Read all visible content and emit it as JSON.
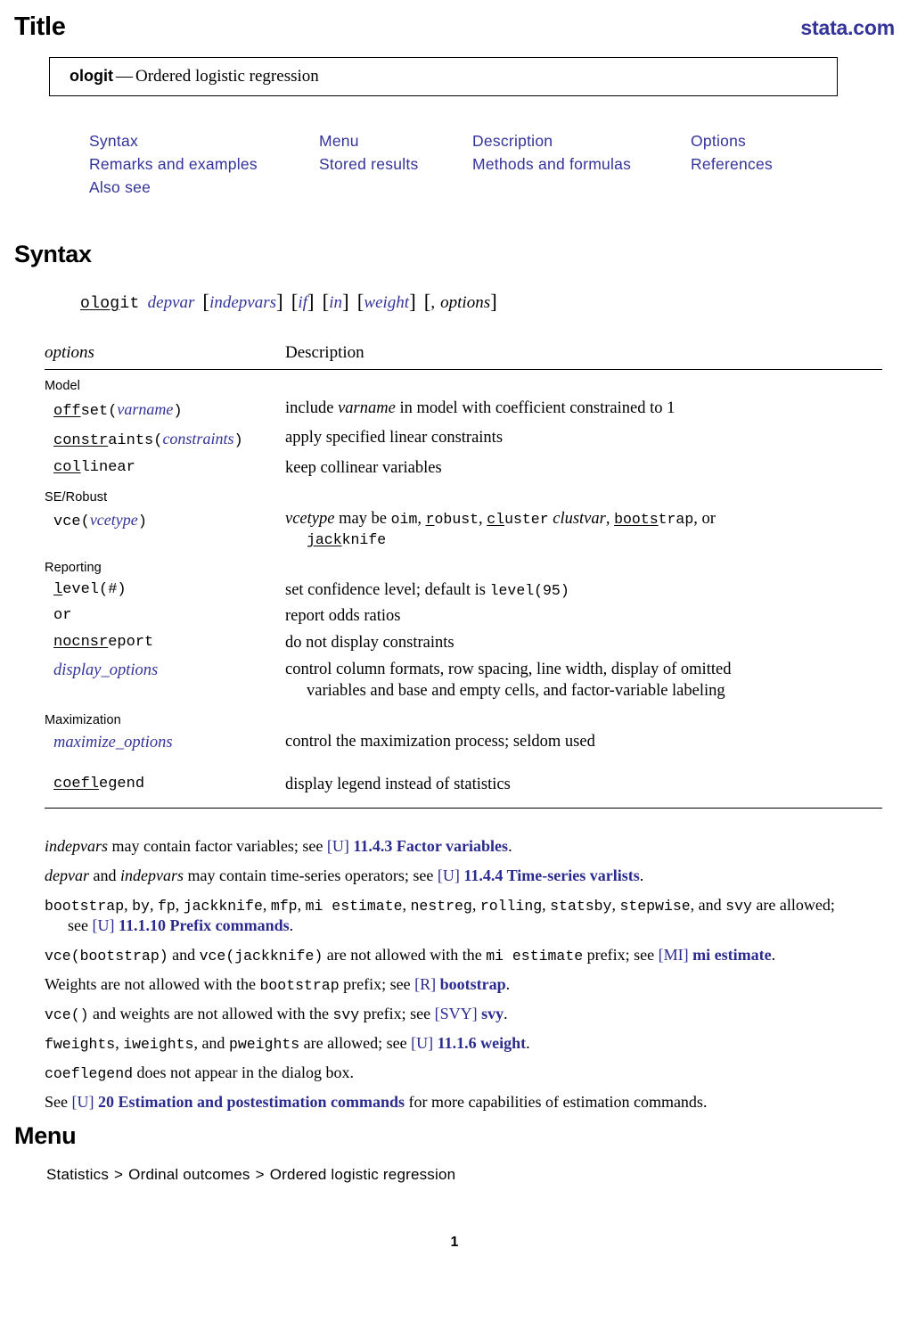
{
  "header": {
    "title": "Title",
    "site": "stata.com"
  },
  "title_box": {
    "command": "ologit",
    "dash": "—",
    "description": "Ordered logistic regression"
  },
  "toc": {
    "items": [
      "Syntax",
      "Menu",
      "Description",
      "Options",
      "Remarks and examples",
      "Stored results",
      "Methods and formulas",
      "References",
      "Also see"
    ]
  },
  "sections": {
    "syntax_heading": "Syntax",
    "menu_heading": "Menu"
  },
  "syntax_line": {
    "cmd_underlined": "olog",
    "cmd_rest": "it",
    "depvar": "depvar",
    "indepvars": "indepvars",
    "if": "if",
    "in": "in",
    "weight": "weight",
    "comma": ",",
    "options": "options",
    "lbrack": "[",
    "rbrack": "]"
  },
  "options_table": {
    "col1_header": "options",
    "col2_header": "Description",
    "groups": [
      {
        "name": "Model",
        "rows": [
          {
            "opt_u": "off",
            "opt_rest": "set(",
            "opt_arg": "varname",
            "opt_tail": ")",
            "desc_pre": "include ",
            "desc_it": "varname",
            "desc_post": " in model with coefficient constrained to 1"
          },
          {
            "opt_u": "constr",
            "opt_rest": "aints(",
            "opt_arg": "constraints",
            "opt_tail": ")",
            "desc_pre": "apply specified linear constraints",
            "desc_it": "",
            "desc_post": ""
          },
          {
            "opt_u": "col",
            "opt_rest": "linear",
            "opt_arg": "",
            "opt_tail": "",
            "desc_pre": "keep collinear variables",
            "desc_it": "",
            "desc_post": ""
          }
        ]
      },
      {
        "name": "SE/Robust",
        "rows": [
          {
            "opt_u": "",
            "opt_rest": "vce(",
            "opt_arg": "vcetype",
            "opt_tail": ")",
            "desc_vce": {
              "lead_it": "vcetype",
              "lead": " may be ",
              "oim": "oim",
              "robust_u": "r",
              "robust_rest": "obust",
              "cluster_u": "cl",
              "cluster_rest": "uster",
              "clustvar": "clustvar",
              "bootstrap_u": "boots",
              "bootstrap_rest": "trap",
              "or": ", or",
              "jackknife_u": "jack",
              "jackknife_rest": "knife"
            }
          }
        ]
      },
      {
        "name": "Reporting",
        "rows": [
          {
            "opt_u": "l",
            "opt_rest": "evel(#)",
            "opt_arg": "",
            "opt_tail": "",
            "desc_pre": "set confidence level; default is ",
            "desc_mono": "level(95)",
            "desc_post": ""
          },
          {
            "opt_u": "",
            "opt_rest": "or",
            "opt_arg": "",
            "opt_tail": "",
            "desc_pre": "report odds ratios",
            "desc_it": "",
            "desc_post": ""
          },
          {
            "opt_u": "nocnsr",
            "opt_rest": "eport",
            "opt_arg": "",
            "opt_tail": "",
            "desc_pre": "do not display constraints",
            "desc_it": "",
            "desc_post": ""
          },
          {
            "opt_italic_link": "display_options",
            "desc_pre": "control column formats, row spacing, line width, display of omitted",
            "desc_cont": "variables and base and empty cells, and factor-variable labeling"
          }
        ]
      },
      {
        "name": "Maximization",
        "rows": [
          {
            "opt_italic_link": "maximize_options",
            "desc_pre": "control the maximization process; seldom used"
          }
        ]
      },
      {
        "name": "",
        "rows": [
          {
            "opt_u": "coefl",
            "opt_rest": "egend",
            "opt_arg": "",
            "opt_tail": "",
            "desc_pre": "display legend instead of statistics",
            "desc_it": "",
            "desc_post": ""
          }
        ]
      }
    ]
  },
  "notes": {
    "n1": {
      "it1": "indepvars",
      "t1": " may contain factor variables; see ",
      "lk_plain": "[U]",
      "lk_bold": " 11.4.3 Factor variables",
      "t2": "."
    },
    "n2": {
      "it1": "depvar",
      "t1": " and ",
      "it2": "indepvars",
      "t2": " may contain time-series operators; see ",
      "lk_plain": "[U]",
      "lk_bold": " 11.4.4 Time-series varlists",
      "t3": "."
    },
    "n3": {
      "mono1": "bootstrap",
      "t1": ", ",
      "mono2": "by",
      "t2": ", ",
      "mono3": "fp",
      "t3": ", ",
      "mono4": "jackknife",
      "t4": ", ",
      "mono5": "mfp",
      "t5": ", ",
      "mono6": "mi estimate",
      "t6": ", ",
      "mono7": "nestreg",
      "t7": ", ",
      "mono8": "rolling",
      "t8": ", ",
      "mono9": "statsby",
      "t9": ", ",
      "mono10": "stepwise",
      "t10": ", and ",
      "mono11": "svy",
      "t11": " are allowed;",
      "cont_pre": "see ",
      "lk_plain": "[U]",
      "lk_bold": " 11.1.10 Prefix commands",
      "cont_post": "."
    },
    "n4": {
      "mono1": "vce(bootstrap)",
      "t1": " and ",
      "mono2": "vce(jackknife)",
      "t2": " are not allowed with the ",
      "mono3": "mi estimate",
      "t3": " prefix; see ",
      "lk_plain": "[MI]",
      "lk_bold": " mi estimate",
      "t4": "."
    },
    "n5": {
      "t1": "Weights are not allowed with the ",
      "mono1": "bootstrap",
      "t2": " prefix; see ",
      "lk_plain": "[R]",
      "lk_bold": " bootstrap",
      "t3": "."
    },
    "n6": {
      "mono1": "vce()",
      "t1": " and weights are not allowed with the ",
      "mono2": "svy",
      "t2": " prefix; see ",
      "lk_plain": "[SVY]",
      "lk_bold": " svy",
      "t3": "."
    },
    "n7": {
      "mono1": "fweights",
      "t1": ", ",
      "mono2": "iweights",
      "t2": ", and ",
      "mono3": "pweights",
      "t3": " are allowed; see ",
      "lk_plain": "[U]",
      "lk_bold": " 11.1.6 weight",
      "t4": "."
    },
    "n8": {
      "mono1": "coeflegend",
      "t1": " does not appear in the dialog box."
    },
    "n9": {
      "t1": "See ",
      "lk_plain": "[U]",
      "lk_bold": " 20 Estimation and postestimation commands",
      "t2": " for more capabilities of estimation commands."
    }
  },
  "menu": {
    "crumb1": "Statistics",
    "sep1": ">",
    "crumb2": "Ordinal outcomes",
    "sep2": ">",
    "crumb3": "Ordered logistic regression"
  },
  "page_number": "1",
  "colors": {
    "link": "#2b2b8f",
    "brand": "#333399",
    "text": "#000000"
  }
}
